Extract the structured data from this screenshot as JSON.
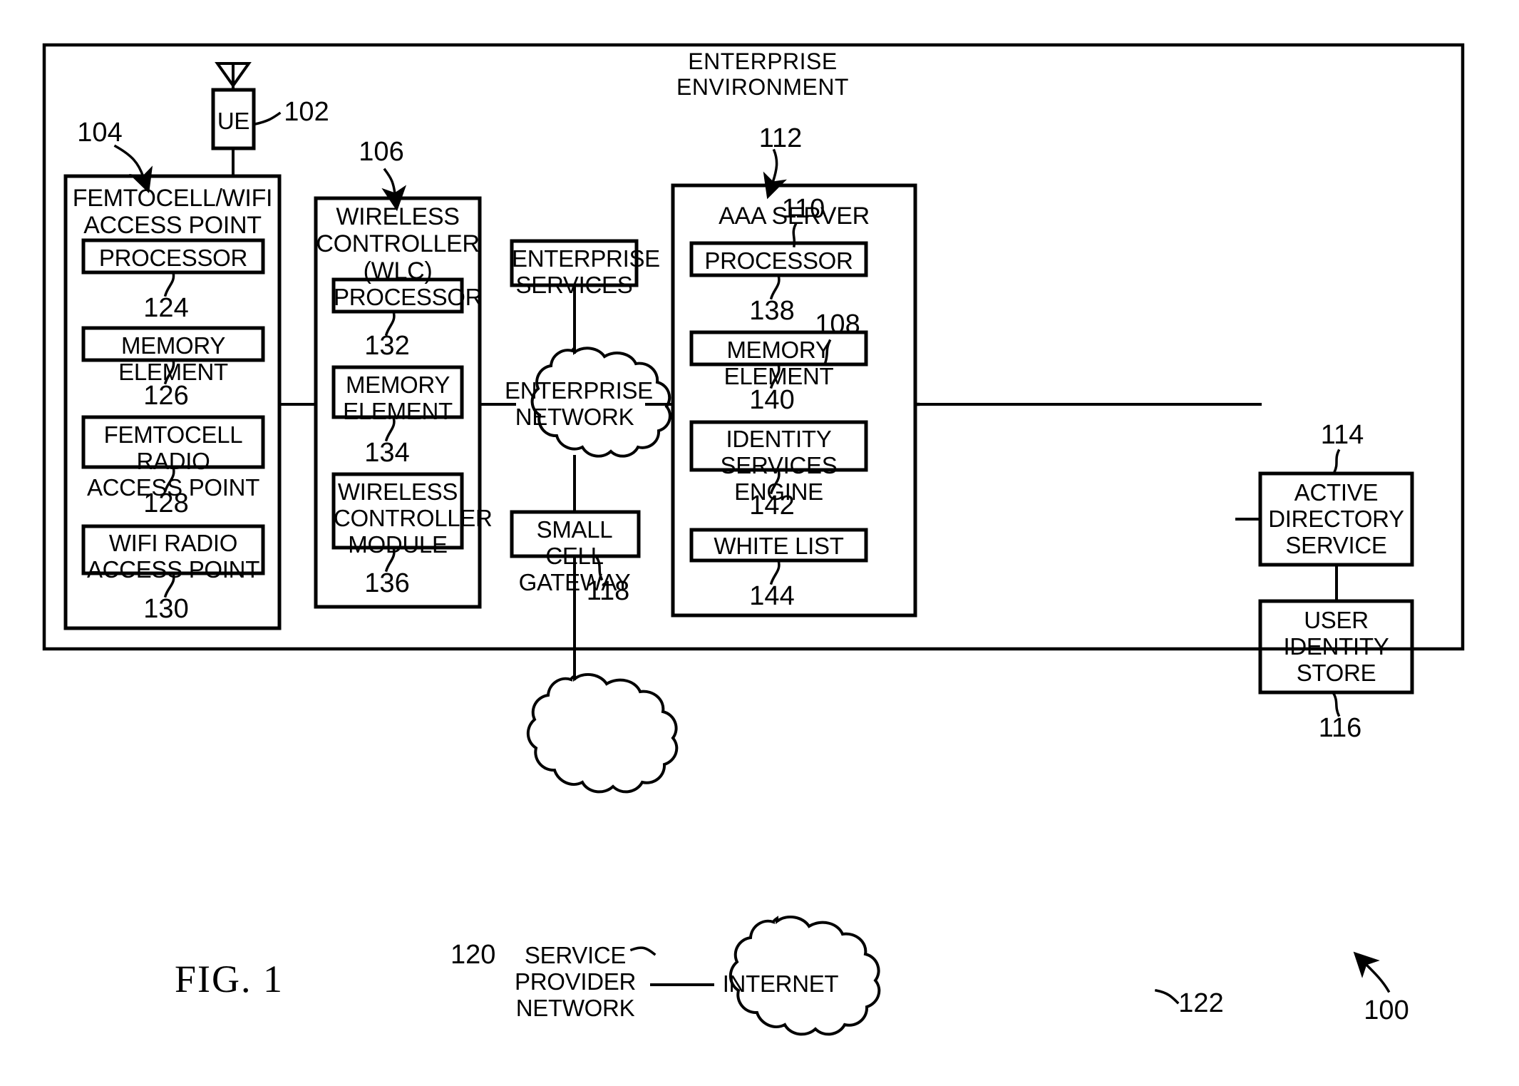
{
  "figure": {
    "label": "FIG. 1",
    "system_ref": "100"
  },
  "environment": {
    "title": "ENTERPRISE ENVIRONMENT"
  },
  "ue": {
    "label": "UE",
    "ref": "102",
    "antenna_icon": "antenna-icon"
  },
  "access_point": {
    "title": "FEMTOCELL/WIFI\nACCESS POINT",
    "ref": "104",
    "components": [
      {
        "label": "PROCESSOR",
        "ref": "124"
      },
      {
        "label": "MEMORY ELEMENT",
        "ref": "126"
      },
      {
        "label": "FEMTOCELL RADIO\nACCESS POINT",
        "ref": "128"
      },
      {
        "label": "WIFI RADIO\nACCESS POINT",
        "ref": "130"
      }
    ]
  },
  "wlc": {
    "title": "WIRELESS\nCONTROLLER\n(WLC)",
    "ref": "106",
    "components": [
      {
        "label": "PROCESSOR",
        "ref": "132"
      },
      {
        "label": "MEMORY\nELEMENT",
        "ref": "134"
      },
      {
        "label": "WIRELESS\nCONTROLLER\nMODULE",
        "ref": "136"
      }
    ]
  },
  "enterprise_services": {
    "label": "ENTERPRISE\nSERVICES",
    "ref": "110"
  },
  "enterprise_network": {
    "label": "ENTERPRISE\nNETWORK",
    "ref": "108"
  },
  "small_cell_gateway": {
    "label": "SMALL CELL\nGATEWAY",
    "ref": "118"
  },
  "aaa_server": {
    "title": "AAA SERVER",
    "ref": "112",
    "components": [
      {
        "label": "PROCESSOR",
        "ref": "138"
      },
      {
        "label": "MEMORY ELEMENT",
        "ref": "140"
      },
      {
        "label": "IDENTITY\nSERVICES ENGINE",
        "ref": "142"
      },
      {
        "label": "WHITE LIST",
        "ref": "144"
      }
    ]
  },
  "active_directory": {
    "label": "ACTIVE\nDIRECTORY\nSERVICE",
    "ref": "114"
  },
  "user_identity_store": {
    "label": "USER\nIDENTITY\nSTORE",
    "ref": "116"
  },
  "service_provider_network": {
    "label": "SERVICE\nPROVIDER\nNETWORK",
    "ref": "120"
  },
  "internet": {
    "label": "INTERNET",
    "ref": "122"
  },
  "style": {
    "stroke": "#000000",
    "background": "#ffffff"
  }
}
